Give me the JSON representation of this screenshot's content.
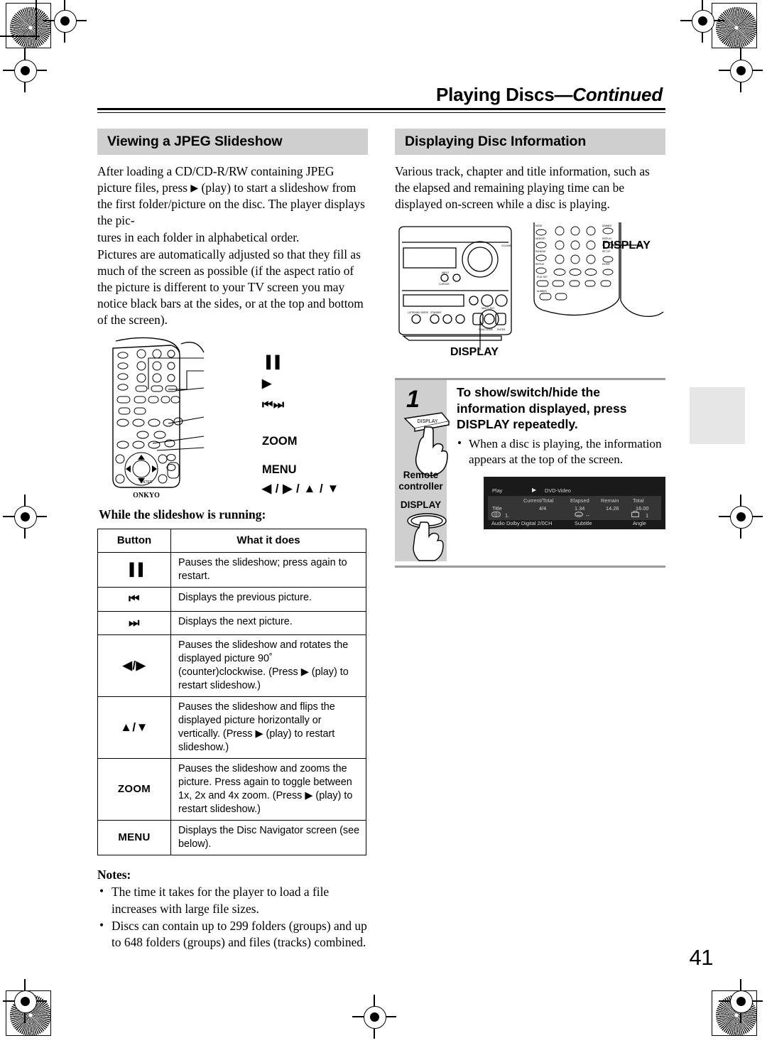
{
  "header": {
    "running_title_main": "Playing Discs",
    "running_title_cont": "—Continued"
  },
  "left_column": {
    "section_title": "Viewing a JPEG Slideshow",
    "paragraphs": [
      "After loading a CD/CD-R/RW containing JPEG picture files, press ▶ (play) to start a slideshow from the first folder/picture on the disc. The player displays the pictures in each folder in alphabetical order.",
      "Pictures are automatically adjusted so that they fill as much of the screen as possible (if the aspect ratio of the picture is different to your TV screen you may notice black bars at the sides, or at the top and bottom of the screen)."
    ],
    "remote_callouts": [
      "▐▐",
      "▶",
      "⏮⏭",
      "ZOOM",
      "MENU",
      "◀ / ▶ / ▲ / ▼"
    ],
    "remote_brand": "ONKYO",
    "table_intro": "While the slideshow is running:",
    "table": {
      "columns": [
        "Button",
        "What it does"
      ],
      "rows": [
        {
          "button": "▐▐",
          "button_kind": "symbol",
          "action": "Pauses the slideshow; press again to restart."
        },
        {
          "button": "⏮",
          "button_kind": "symbol",
          "action": "Displays the previous picture."
        },
        {
          "button": "⏭",
          "button_kind": "symbol",
          "action": "Displays the next picture."
        },
        {
          "button": "◀/▶",
          "button_kind": "symbol",
          "action": "Pauses the slideshow and rotates the displayed picture 90˚ (counter)clockwise. (Press ▶ (play) to restart slideshow.)"
        },
        {
          "button": "▲/▼",
          "button_kind": "symbol",
          "action": "Pauses the slideshow and flips the displayed picture horizontally or vertically. (Press ▶ (play) to restart slideshow.)"
        },
        {
          "button": "ZOOM",
          "button_kind": "word",
          "action": "Pauses the slideshow and zooms the picture. Press again to toggle between 1x, 2x and 4x zoom. (Press ▶ (play) to restart slideshow.)"
        },
        {
          "button": "MENU",
          "button_kind": "word",
          "action": "Displays the Disc Navigator screen (see below)."
        }
      ]
    },
    "notes_heading": "Notes:",
    "notes": [
      "The time it takes for the player to load a file increases with large file sizes.",
      "Discs can contain up to 299 folders (groups) and up to 648 folders (groups) and files (tracks) combined."
    ]
  },
  "right_column": {
    "section_title": "Displaying Disc Information",
    "paragraphs": [
      "Various track, chapter and title information, such as the elapsed and remaining playing time can be displayed on-screen while a disc is playing."
    ],
    "art_labels": {
      "receiver_display": "DISPLAY",
      "remote_display": "DISPLAY"
    },
    "step": {
      "number": "1",
      "heading": "To show/switch/hide the information displayed, press DISPLAY repeatedly.",
      "bullet": "When a disc is playing, the information appears at the top of the screen.",
      "key_art_label": "DISPLAY",
      "device_label_line1": "Remote",
      "device_label_line2": "controller",
      "device_button_label": "DISPLAY"
    },
    "osd": {
      "status": "Play",
      "disc_type": "DVD-Video",
      "headers": [
        "Current/Total",
        "Elapsed",
        "Remain",
        "Total"
      ],
      "row_label": "Title",
      "row_values": [
        "4/4",
        "1.34",
        "14.26",
        "16.00"
      ],
      "audio_index": "1.",
      "audio_label": "Audio Dolby Digital 2/0CH",
      "subtitle_value": "--",
      "subtitle_label": "Subtitle",
      "angle_value": "1",
      "angle_label": "Angle"
    }
  },
  "page_number": "41",
  "colors": {
    "section_header_bg": "#cfcfcf",
    "step_gray_bg": "#cfcfcf",
    "thumb_tab": "#e6e6e6",
    "osd_bg": "#1a1a1a",
    "osd_band": "#353535"
  }
}
